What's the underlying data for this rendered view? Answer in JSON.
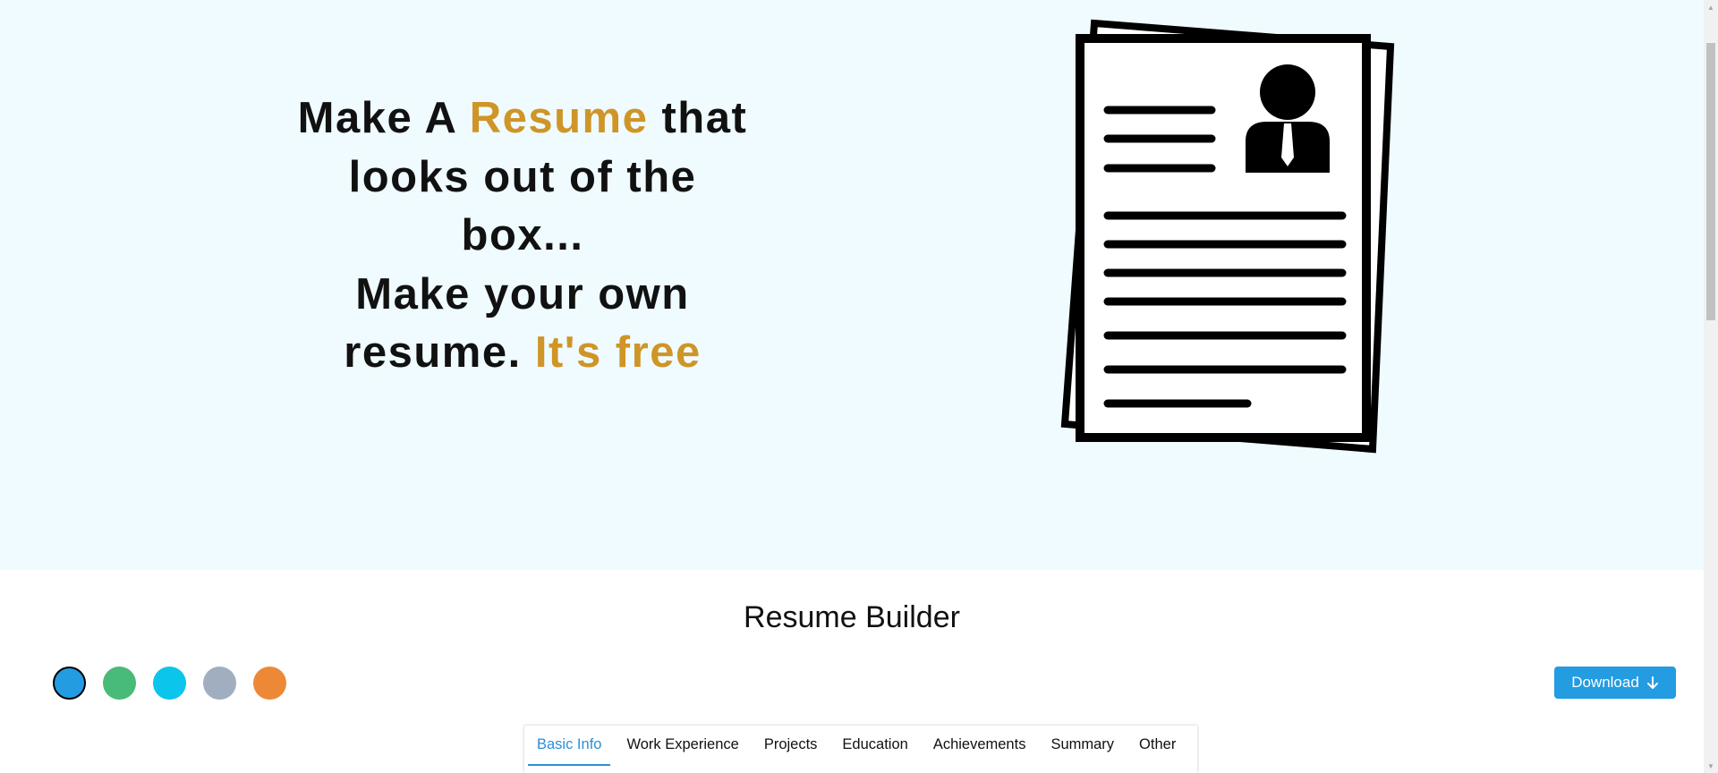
{
  "hero": {
    "line1_pre": "Make A ",
    "line1_accent": "Resume",
    "line1_post": " that",
    "line2": "looks out of the",
    "line3": "box...",
    "line4": "Make your own",
    "line5_pre": "resume. ",
    "line5_accent": "It's free",
    "illustration_icon": "resume-document-icon"
  },
  "builder": {
    "title": "Resume Builder",
    "download_label": "Download",
    "download_icon": "arrow-down-icon"
  },
  "colors": {
    "hero_bg": "#effbfe",
    "accent": "#cf9527",
    "primary": "#239ce2",
    "swatches": [
      "#239ce2",
      "#48bb78",
      "#0bc5ea",
      "#a0aec0",
      "#ed8936"
    ]
  },
  "swatches_selected_index": 0,
  "tabs": [
    {
      "label": "Basic Info",
      "active": true
    },
    {
      "label": "Work Experience",
      "active": false
    },
    {
      "label": "Projects",
      "active": false
    },
    {
      "label": "Education",
      "active": false
    },
    {
      "label": "Achievements",
      "active": false
    },
    {
      "label": "Summary",
      "active": false
    },
    {
      "label": "Other",
      "active": false
    }
  ]
}
